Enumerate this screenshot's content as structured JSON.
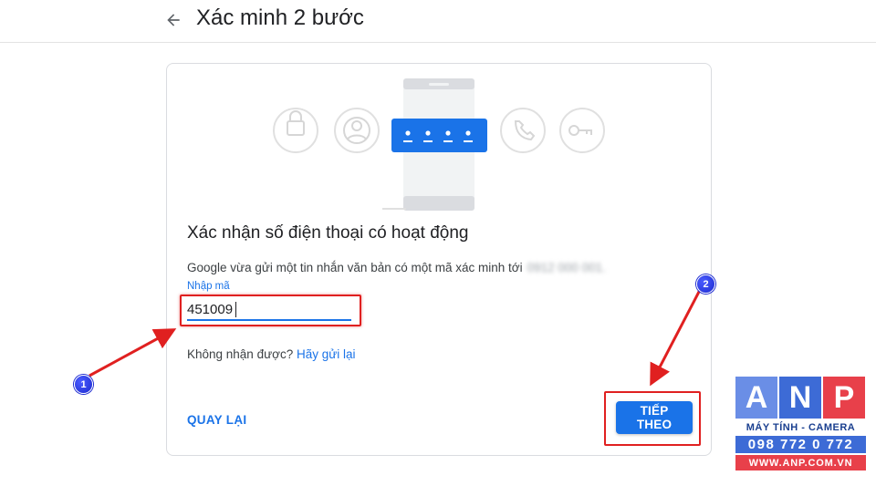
{
  "header": {
    "title": "Xác minh 2 bước",
    "back_icon": "arrow-left-icon"
  },
  "illustration": {
    "icons": [
      "lock-icon",
      "account-circle-icon",
      "phone-icon",
      "key-icon"
    ],
    "pin_display": "• • • •"
  },
  "card": {
    "heading": "Xác nhận số điện thoại có hoạt động",
    "description": "Google vừa gửi một tin nhắn văn bản có một mã xác minh tới",
    "phone_masked": "0912 000 001.",
    "code_label": "Nhập mã",
    "code_value": "451009",
    "resend_prefix": "Không nhận được?",
    "resend_link": "Hãy gửi lại",
    "back_button": "QUAY LẠI",
    "next_button": "TIẾP THEO"
  },
  "annotations": {
    "badge_1": "1",
    "badge_2": "2",
    "highlight_color": "#e02020",
    "badge_color": "#1c2ad0"
  },
  "watermark": {
    "letters": [
      "A",
      "N",
      "P"
    ],
    "letter_colors": [
      "#6a8ee6",
      "#3d6bd6",
      "#e8404a"
    ],
    "tagline": "MÁY TÍNH - CAMERA",
    "phone": "098 772 0 772",
    "website": "WWW.ANP.COM.VN"
  },
  "colors": {
    "accent": "#1a73e8",
    "text_primary": "#202124",
    "border": "#dadce0"
  }
}
